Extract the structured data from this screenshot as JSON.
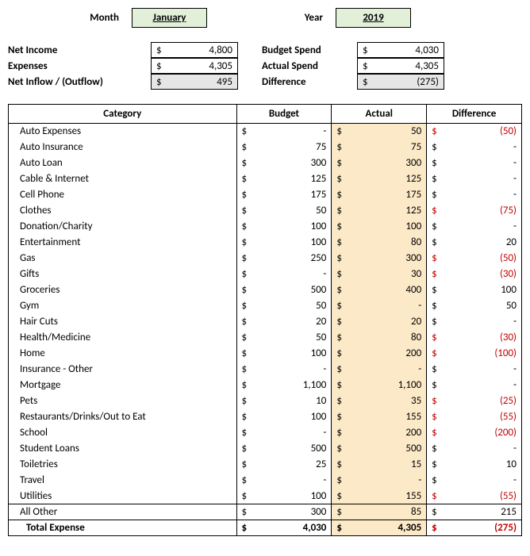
{
  "period": {
    "month_label": "Month",
    "month": "January",
    "year_label": "Year",
    "year": "2019"
  },
  "summary_left": [
    {
      "label": "Net Income",
      "value": "4,800",
      "shaded": false,
      "paren": false
    },
    {
      "label": "Expenses",
      "value": "4,305",
      "shaded": false,
      "paren": false
    },
    {
      "label": "Net Inflow / (Outflow)",
      "value": "495",
      "shaded": true,
      "paren": false
    }
  ],
  "summary_right": [
    {
      "label": "Budget Spend",
      "value": "4,030",
      "shaded": false,
      "paren": false
    },
    {
      "label": "Actual Spend",
      "value": "4,305",
      "shaded": false,
      "paren": false
    },
    {
      "label": "Difference",
      "value": "(275)",
      "shaded": true,
      "paren": true
    }
  ],
  "headers": {
    "category": "Category",
    "budget": "Budget",
    "actual": "Actual",
    "difference": "Difference"
  },
  "rows": [
    {
      "category": "Auto Expenses",
      "budget": "-",
      "actual": "50",
      "diff": "(50)",
      "neg": true
    },
    {
      "category": "Auto Insurance",
      "budget": "75",
      "actual": "75",
      "diff": "-",
      "neg": false
    },
    {
      "category": "Auto Loan",
      "budget": "300",
      "actual": "300",
      "diff": "-",
      "neg": false
    },
    {
      "category": "Cable & Internet",
      "budget": "125",
      "actual": "125",
      "diff": "-",
      "neg": false
    },
    {
      "category": "Cell Phone",
      "budget": "175",
      "actual": "175",
      "diff": "-",
      "neg": false
    },
    {
      "category": "Clothes",
      "budget": "50",
      "actual": "125",
      "diff": "(75)",
      "neg": true
    },
    {
      "category": "Donation/Charity",
      "budget": "100",
      "actual": "100",
      "diff": "-",
      "neg": false
    },
    {
      "category": "Entertainment",
      "budget": "100",
      "actual": "80",
      "diff": "20",
      "neg": false
    },
    {
      "category": "Gas",
      "budget": "250",
      "actual": "300",
      "diff": "(50)",
      "neg": true
    },
    {
      "category": "Gifts",
      "budget": "-",
      "actual": "30",
      "diff": "(30)",
      "neg": true
    },
    {
      "category": "Groceries",
      "budget": "500",
      "actual": "400",
      "diff": "100",
      "neg": false
    },
    {
      "category": "Gym",
      "budget": "50",
      "actual": "-",
      "diff": "50",
      "neg": false
    },
    {
      "category": "Hair Cuts",
      "budget": "20",
      "actual": "20",
      "diff": "-",
      "neg": false
    },
    {
      "category": "Health/Medicine",
      "budget": "50",
      "actual": "80",
      "diff": "(30)",
      "neg": true
    },
    {
      "category": "Home",
      "budget": "100",
      "actual": "200",
      "diff": "(100)",
      "neg": true
    },
    {
      "category": "Insurance - Other",
      "budget": "-",
      "actual": "-",
      "diff": "-",
      "neg": false
    },
    {
      "category": "Mortgage",
      "budget": "1,100",
      "actual": "1,100",
      "diff": "-",
      "neg": false
    },
    {
      "category": "Pets",
      "budget": "10",
      "actual": "35",
      "diff": "(25)",
      "neg": true
    },
    {
      "category": "Restaurants/Drinks/Out to Eat",
      "budget": "100",
      "actual": "155",
      "diff": "(55)",
      "neg": true
    },
    {
      "category": "School",
      "budget": "-",
      "actual": "200",
      "diff": "(200)",
      "neg": true
    },
    {
      "category": "Student Loans",
      "budget": "500",
      "actual": "500",
      "diff": "-",
      "neg": false
    },
    {
      "category": "Toiletries",
      "budget": "25",
      "actual": "15",
      "diff": "10",
      "neg": false
    },
    {
      "category": "Travel",
      "budget": "-",
      "actual": "-",
      "diff": "-",
      "neg": false
    },
    {
      "category": "Utilities",
      "budget": "100",
      "actual": "155",
      "diff": "(55)",
      "neg": true
    }
  ],
  "all_other": {
    "category": "All Other",
    "budget": "300",
    "actual": "85",
    "diff": "215",
    "neg": false
  },
  "total": {
    "category": "Total Expense",
    "budget": "4,030",
    "actual": "4,305",
    "diff": "(275)",
    "neg": true
  },
  "chart_data": {
    "type": "table",
    "title": "Monthly Budget vs Actual - January 2019",
    "columns": [
      "Category",
      "Budget",
      "Actual",
      "Difference"
    ],
    "rows": [
      [
        "Auto Expenses",
        0,
        50,
        -50
      ],
      [
        "Auto Insurance",
        75,
        75,
        0
      ],
      [
        "Auto Loan",
        300,
        300,
        0
      ],
      [
        "Cable & Internet",
        125,
        125,
        0
      ],
      [
        "Cell Phone",
        175,
        175,
        0
      ],
      [
        "Clothes",
        50,
        125,
        -75
      ],
      [
        "Donation/Charity",
        100,
        100,
        0
      ],
      [
        "Entertainment",
        100,
        80,
        20
      ],
      [
        "Gas",
        250,
        300,
        -50
      ],
      [
        "Gifts",
        0,
        30,
        -30
      ],
      [
        "Groceries",
        500,
        400,
        100
      ],
      [
        "Gym",
        50,
        0,
        50
      ],
      [
        "Hair Cuts",
        20,
        20,
        0
      ],
      [
        "Health/Medicine",
        50,
        80,
        -30
      ],
      [
        "Home",
        100,
        200,
        -100
      ],
      [
        "Insurance - Other",
        0,
        0,
        0
      ],
      [
        "Mortgage",
        1100,
        1100,
        0
      ],
      [
        "Pets",
        10,
        35,
        -25
      ],
      [
        "Restaurants/Drinks/Out to Eat",
        100,
        155,
        -55
      ],
      [
        "School",
        0,
        200,
        -200
      ],
      [
        "Student Loans",
        500,
        500,
        0
      ],
      [
        "Toiletries",
        25,
        15,
        10
      ],
      [
        "Travel",
        0,
        0,
        0
      ],
      [
        "Utilities",
        100,
        155,
        -55
      ],
      [
        "All Other",
        300,
        85,
        215
      ],
      [
        "Total Expense",
        4030,
        4305,
        -275
      ]
    ],
    "summary": {
      "net_income": 4800,
      "expenses": 4305,
      "net_inflow": 495,
      "budget_spend": 4030,
      "actual_spend": 4305,
      "difference": -275
    }
  }
}
